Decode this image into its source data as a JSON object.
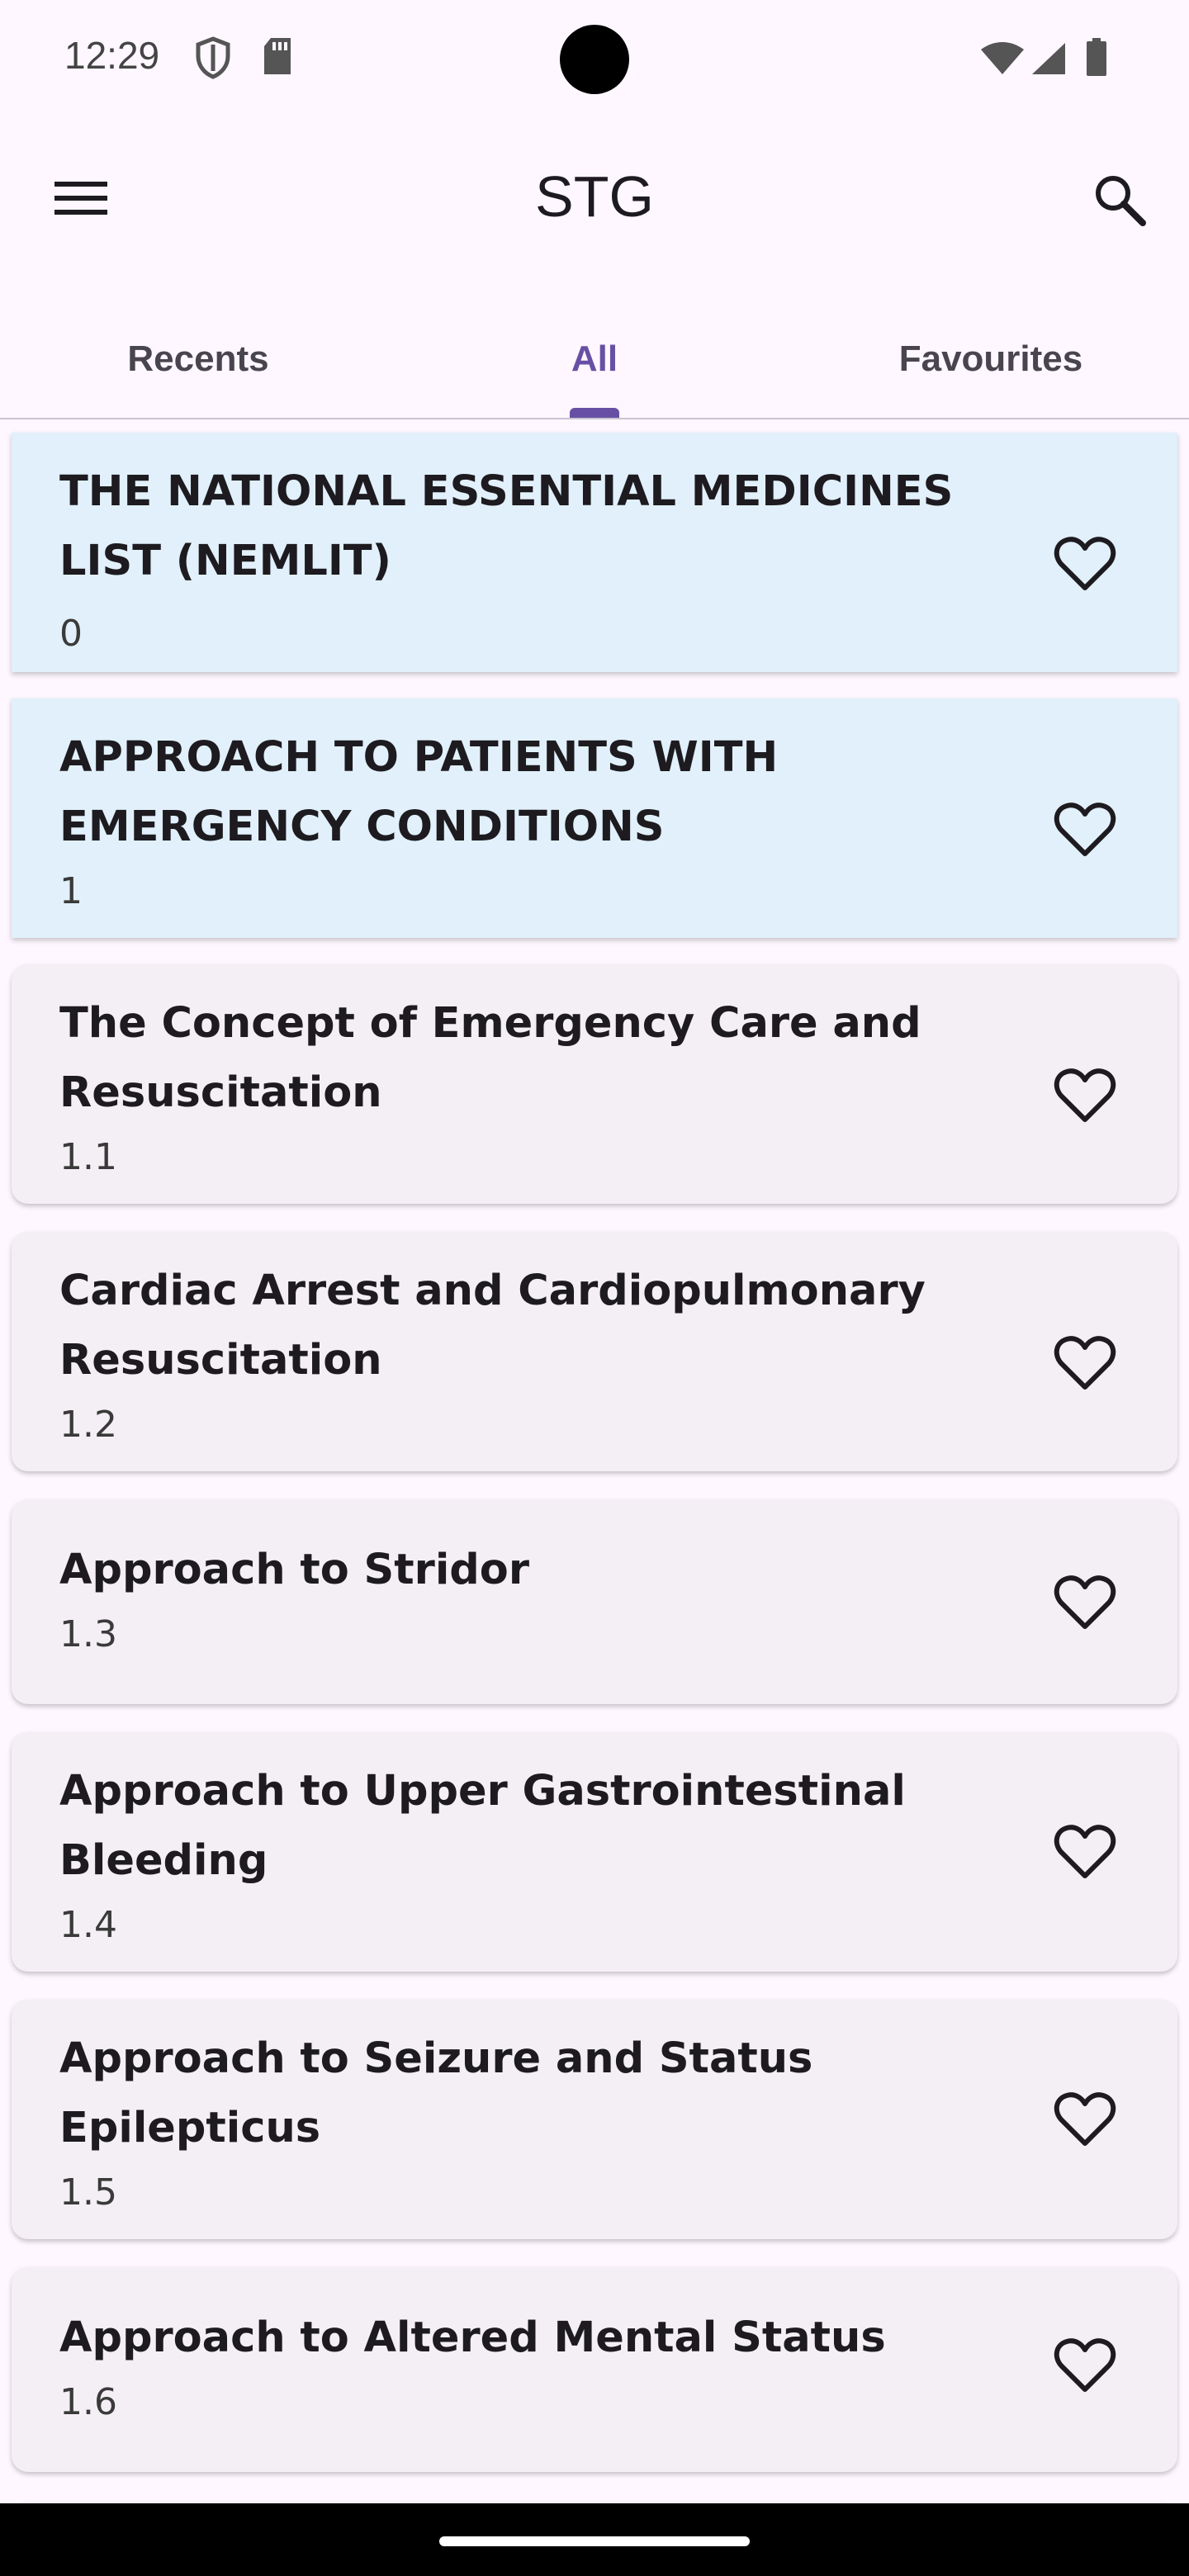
{
  "status_bar": {
    "time": "12:29",
    "icons": [
      "shield-icon",
      "sd-card-icon",
      "wifi-icon",
      "cell-signal-icon",
      "battery-icon"
    ]
  },
  "app_bar": {
    "title": "STG",
    "menu_icon": "hamburger-menu-icon",
    "search_icon": "search-icon"
  },
  "tabs": [
    {
      "label": "Recents",
      "active": false
    },
    {
      "label": "All",
      "active": true
    },
    {
      "label": "Favourites",
      "active": false
    }
  ],
  "colors": {
    "accent": "#6750A4",
    "highlight_card": "#E1F0FA",
    "card": "#F4EFF4",
    "background": "#FEF7FF"
  },
  "items": [
    {
      "title_lines": [
        "THE NATIONAL ESSENTIAL MEDICINES",
        "LIST (NEMLIT)"
      ],
      "number": "0",
      "highlighted": true
    },
    {
      "title_lines": [
        "APPROACH TO PATIENTS WITH",
        "EMERGENCY CONDITIONS"
      ],
      "number": "1",
      "highlighted": true
    },
    {
      "title_lines": [
        "The Concept of Emergency Care and",
        "Resuscitation"
      ],
      "number": "1.1",
      "highlighted": false
    },
    {
      "title_lines": [
        "Cardiac Arrest and Cardiopulmonary",
        "Resuscitation"
      ],
      "number": "1.2",
      "highlighted": false
    },
    {
      "title_lines": [
        "Approach to Stridor"
      ],
      "number": "1.3",
      "highlighted": false
    },
    {
      "title_lines": [
        "Approach to Upper Gastrointestinal",
        "Bleeding"
      ],
      "number": "1.4",
      "highlighted": false
    },
    {
      "title_lines": [
        "Approach to Seizure and Status",
        "Epilepticus"
      ],
      "number": "1.5",
      "highlighted": false
    },
    {
      "title_lines": [
        "Approach to Altered Mental Status"
      ],
      "number": "1.6",
      "highlighted": false
    }
  ]
}
